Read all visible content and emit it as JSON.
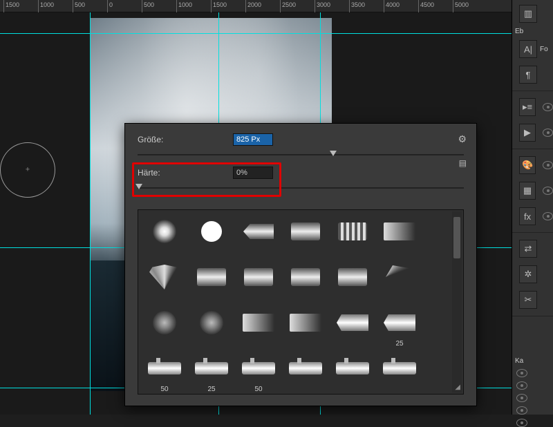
{
  "ruler_ticks": [
    "1500",
    "1000",
    "500",
    "0",
    "500",
    "1000",
    "1500",
    "2000",
    "2500",
    "3000",
    "3500",
    "4000",
    "4500",
    "5000"
  ],
  "brush_panel": {
    "size_label": "Größe:",
    "size_value": "825 Px",
    "hardness_label": "Härte:",
    "hardness_value": "0%",
    "gear_icon": "⚙",
    "flyout_icon": "▤"
  },
  "presets": {
    "row1": [
      {
        "name": "soft-round",
        "cap": ""
      },
      {
        "name": "hard-round",
        "cap": ""
      },
      {
        "name": "pointed-tip",
        "cap": ""
      },
      {
        "name": "flat",
        "cap": ""
      },
      {
        "name": "stripe",
        "cap": ""
      },
      {
        "name": "smear",
        "cap": ""
      }
    ],
    "row2": [
      {
        "name": "fan",
        "cap": ""
      },
      {
        "name": "flat",
        "cap": ""
      },
      {
        "name": "flat",
        "cap": ""
      },
      {
        "name": "flat",
        "cap": ""
      },
      {
        "name": "flat",
        "cap": ""
      },
      {
        "name": "fan-r",
        "cap": ""
      }
    ],
    "row3": [
      {
        "name": "soft-g",
        "cap": ""
      },
      {
        "name": "soft-g",
        "cap": ""
      },
      {
        "name": "smear",
        "cap": ""
      },
      {
        "name": "smear",
        "cap": ""
      },
      {
        "name": "chisel",
        "cap": ""
      },
      {
        "name": "chisel",
        "cap": "25"
      }
    ],
    "row4": [
      {
        "name": "air",
        "cap": "50"
      },
      {
        "name": "air",
        "cap": "25"
      },
      {
        "name": "air",
        "cap": "50"
      },
      {
        "name": "air",
        "cap": ""
      },
      {
        "name": "air",
        "cap": ""
      },
      {
        "name": "air",
        "cap": ""
      }
    ]
  },
  "sidebar": {
    "tab1": "Eb",
    "tab2": "Ka",
    "fx": "fx"
  }
}
